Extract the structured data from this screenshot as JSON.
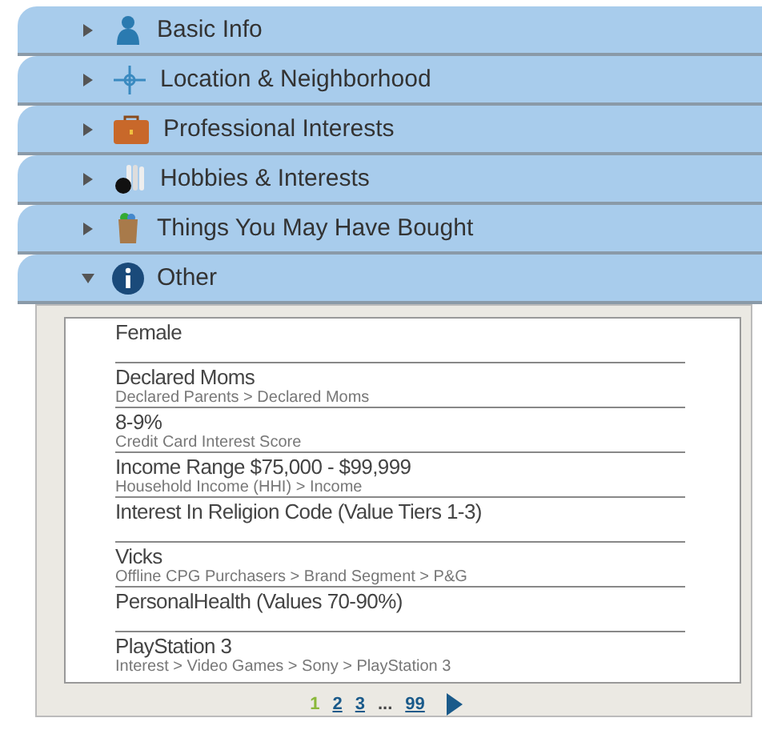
{
  "sections": [
    {
      "title": "Basic Info",
      "expanded": false
    },
    {
      "title": "Location & Neighborhood",
      "expanded": false
    },
    {
      "title": "Professional Interests",
      "expanded": false
    },
    {
      "title": "Hobbies & Interests",
      "expanded": false
    },
    {
      "title": "Things You May Have Bought",
      "expanded": false
    },
    {
      "title": "Other",
      "expanded": true
    }
  ],
  "rows": [
    {
      "value": "Female"
    },
    {
      "value": "Declared Moms",
      "path": "Declared Parents > Declared Moms"
    },
    {
      "value": "8-9%",
      "path": "Credit Card Interest Score"
    },
    {
      "value": "Income Range $75,000 - $99,999",
      "path": "Household Income (HHI) > Income"
    },
    {
      "value": "Interest In Religion Code (Value Tiers 1-3)"
    },
    {
      "value": "Vicks",
      "path": "Offline CPG Purchasers > Brand Segment > P&G"
    },
    {
      "value": "PersonalHealth (Values 70-90%)"
    },
    {
      "value": "PlayStation 3",
      "path": "Interest > Video Games > Sony > PlayStation 3"
    }
  ],
  "pagination": {
    "pages": [
      {
        "kind": "page",
        "label": "1",
        "selected": true
      },
      {
        "kind": "page",
        "label": "2",
        "selected": false
      },
      {
        "kind": "page",
        "label": "3",
        "selected": false
      },
      {
        "kind": "gap",
        "label": "..."
      },
      {
        "kind": "page",
        "label": "99",
        "selected": false
      }
    ]
  }
}
